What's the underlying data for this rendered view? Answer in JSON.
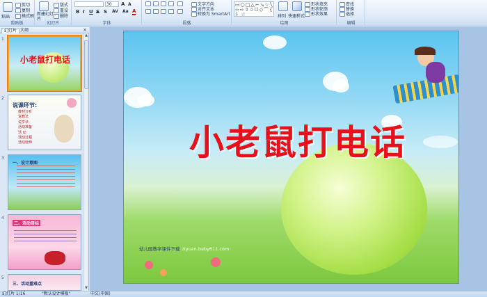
{
  "ribbon": {
    "clipboard": {
      "paste": "粘贴",
      "cut": "剪切",
      "copy": "复制",
      "format_painter": "格式刷",
      "label": "剪贴板"
    },
    "slides": {
      "new_slide": "新建幻灯片",
      "layout": "版式",
      "reset": "重设",
      "delete": "删除",
      "label": "幻灯片"
    },
    "font": {
      "size": "30",
      "label": "字体"
    },
    "paragraph": {
      "text_direction": "文字方向",
      "align_text": "对齐文本",
      "smartart": "转换为 SmartArt",
      "label": "段落"
    },
    "drawing": {
      "arrange": "排列",
      "quick_styles": "快速样式",
      "shape_fill": "形状填充",
      "shape_outline": "形状轮廓",
      "shape_effects": "形状效果",
      "label": "绘图"
    },
    "editing": {
      "find": "查找",
      "replace": "替换",
      "select": "选择",
      "label": "编辑"
    }
  },
  "panel": {
    "tabs": [
      "幻灯片",
      "大纲"
    ],
    "close": "×"
  },
  "thumbnails": [
    {
      "num": "1",
      "title": "小老鼠打电话",
      "lines": []
    },
    {
      "num": "2",
      "title": "说课环节:",
      "lines": [
        "教材分析",
        "说教法",
        "说学法",
        "活动准备",
        "活    动",
        "活动过程",
        "活动延伸"
      ]
    },
    {
      "num": "3",
      "title": "一、设计意图",
      "lines": []
    },
    {
      "num": "4",
      "title": "二、活动目标",
      "lines": []
    },
    {
      "num": "5",
      "title": "三、活动重难点",
      "lines": []
    }
  ],
  "slide": {
    "title": "小老鼠打电话",
    "credit": "幼儿园教学课件下载",
    "credit_url": "ziyuan.baby611.com"
  },
  "status": {
    "slide_pos": "幻灯片 1/16",
    "theme": "\"默认设计模板\"",
    "language": "中文(中国)"
  }
}
